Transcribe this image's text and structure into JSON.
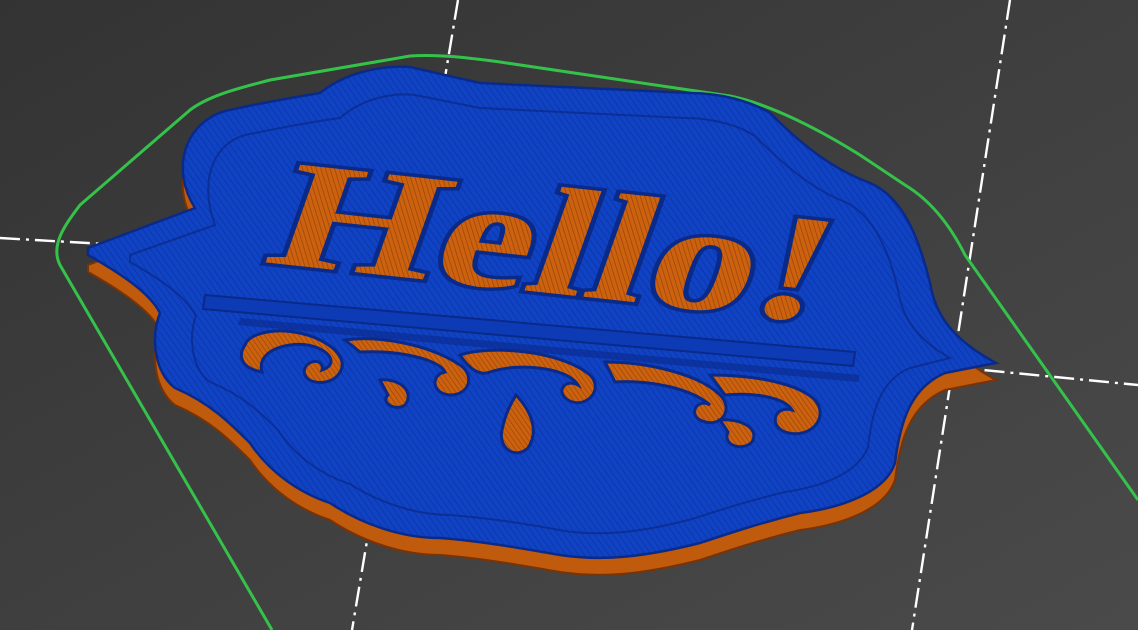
{
  "viewport": {
    "label": "slicer-layer-preview"
  },
  "model": {
    "text": "Hello!",
    "colors": {
      "top_layer": "#0f3fbf",
      "top_layer_edge": "#0a2a8a",
      "bottom_layer": "#c05a0c",
      "bottom_layer_edge": "#7a3305",
      "bed": "#3c3c3c",
      "bed_grid": "#ffffff",
      "skirt": "#35c24a"
    }
  }
}
